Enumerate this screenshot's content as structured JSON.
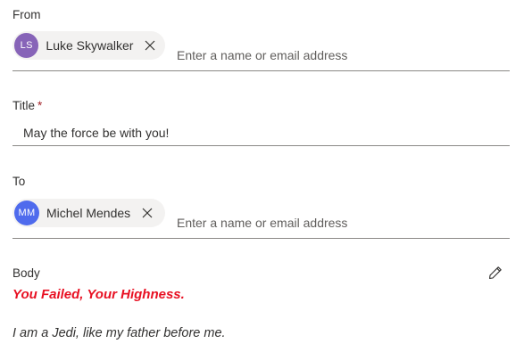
{
  "from": {
    "label": "From",
    "person": {
      "initials": "LS",
      "name": "Luke Skywalker",
      "avatar_color": "#8764b8"
    },
    "input_placeholder": "Enter a name or email address"
  },
  "title": {
    "label": "Title",
    "required_marker": "*",
    "value": "May the force be with you!"
  },
  "to": {
    "label": "To",
    "person": {
      "initials": "MM",
      "name": "Michel Mendes",
      "avatar_color": "#4f6bed"
    },
    "input_placeholder": "Enter a name or email address"
  },
  "body": {
    "label": "Body",
    "heading": "You Failed, Your Highness.",
    "text": "I am a Jedi, like my father before me.",
    "heading_color": "#e81123",
    "edit_icon": "pencil-icon"
  }
}
